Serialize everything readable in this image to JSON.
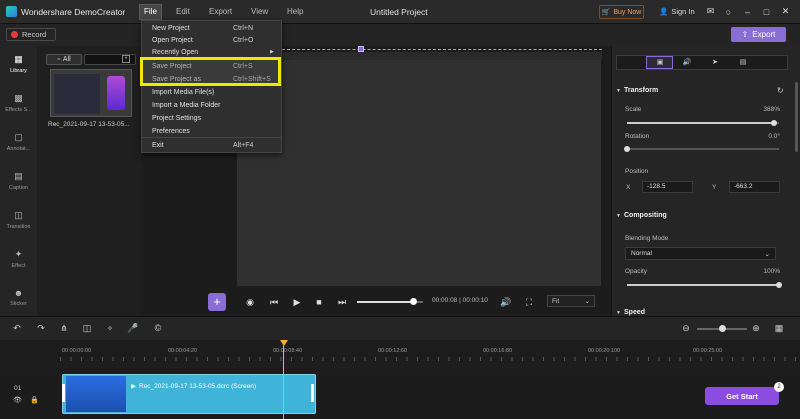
{
  "app": {
    "name": "Wondershare DemoCreator",
    "project_title": "Untitled Project"
  },
  "menubar": [
    "File",
    "Edit",
    "Export",
    "View",
    "Help"
  ],
  "titlebar_right": {
    "buy_now": "Buy Now",
    "sign_in": "Sign In"
  },
  "toolbar": {
    "record": "Record",
    "export": "Export"
  },
  "sidebar": [
    {
      "label": "Library",
      "icon": "library-icon"
    },
    {
      "label": "Effects S...",
      "icon": "effects-icon"
    },
    {
      "label": "Annotat...",
      "icon": "annotation-icon"
    },
    {
      "label": "Caption",
      "icon": "caption-icon"
    },
    {
      "label": "Transition",
      "icon": "transition-icon"
    },
    {
      "label": "Effect",
      "icon": "effect-icon"
    },
    {
      "label": "Sticker",
      "icon": "sticker-icon"
    }
  ],
  "library": {
    "tab_all": "All",
    "item_label": "Rec_2021-09-17 13-53-05..."
  },
  "file_menu": [
    {
      "label": "New Project",
      "shortcut": "Ctrl+N"
    },
    {
      "label": "Open Project",
      "shortcut": "Ctrl+O"
    },
    {
      "label": "Recently Open",
      "shortcut": ""
    },
    {
      "label": "Save Project",
      "shortcut": "Ctrl+S"
    },
    {
      "label": "Save Project as",
      "shortcut": "Ctrl+Shift+S"
    },
    {
      "label": "Import Media File(s)",
      "shortcut": ""
    },
    {
      "label": "Import a Media Folder",
      "shortcut": ""
    },
    {
      "label": "Project Settings",
      "shortcut": ""
    },
    {
      "label": "Preferences",
      "shortcut": ""
    },
    {
      "label": "Exit",
      "shortcut": "Alt+F4"
    }
  ],
  "playback": {
    "timecode": "00:00:08 | 00:00:10",
    "fit": "Fit",
    "progress": 0.85
  },
  "properties": {
    "transform": "Transform",
    "scale_label": "Scale",
    "scale_value": "388%",
    "scale_fraction": 0.97,
    "rotation_label": "Rotation",
    "rotation_value": "0.0°",
    "rotation_fraction": 0.0,
    "position_label": "Position",
    "x_label": "X",
    "x_value": "-128.5",
    "y_label": "Y",
    "y_value": "-663.2",
    "compositing": "Compositing",
    "blending_label": "Blending Mode",
    "blending_value": "Normal",
    "opacity_label": "Opacity",
    "opacity_value": "100%",
    "opacity_fraction": 1.0,
    "speed": "Speed"
  },
  "ruler": [
    "00:00:00:00",
    "00:00:04:20",
    "00:00:08:40",
    "00:00:12:60",
    "00:00:16:80",
    "00:00:20:100",
    "00:00:25:00"
  ],
  "track": {
    "number": "01",
    "clip_label": "Rec_2021-09-17 13-53-05.dcrc (Screen)"
  },
  "get_start": {
    "label": "Get Start",
    "badge": "2"
  },
  "colors": {
    "accent": "#8a6cd6",
    "highlight": "#f3e600",
    "clip": "#3fb3d8",
    "playhead": "#f0b429"
  }
}
